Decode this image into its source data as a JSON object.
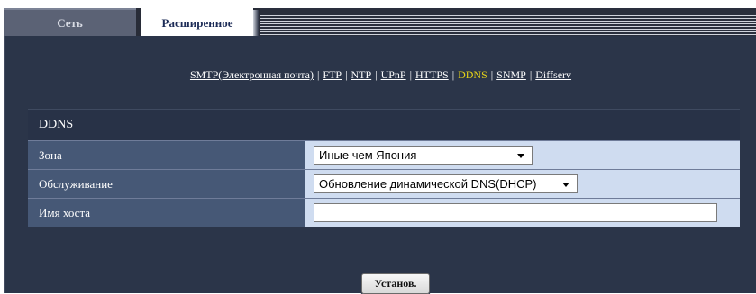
{
  "tabs": [
    {
      "label": "Сеть",
      "active": false
    },
    {
      "label": "Расширенное",
      "active": true
    }
  ],
  "nav_links": [
    {
      "label": "SMTP(Электронная почта)",
      "current": false
    },
    {
      "label": "FTP",
      "current": false
    },
    {
      "label": "NTP",
      "current": false
    },
    {
      "label": "UPnP",
      "current": false
    },
    {
      "label": "HTTPS",
      "current": false
    },
    {
      "label": "DDNS",
      "current": true
    },
    {
      "label": "SNMP",
      "current": false
    },
    {
      "label": "Diffserv",
      "current": false
    }
  ],
  "section": {
    "title": "DDNS",
    "rows": {
      "zone": {
        "label": "Зона",
        "value": "Иные чем Япония"
      },
      "service": {
        "label": "Обслуживание",
        "value": "Обновление динамической DNS(DHCP)"
      },
      "hostname": {
        "label": "Имя хоста",
        "value": ""
      }
    }
  },
  "submit_label": "Установ.",
  "colors": {
    "panel": "#2b3549",
    "label_cell": "#465876",
    "value_cell": "#cfdcf0",
    "current_link": "#e6d318"
  }
}
